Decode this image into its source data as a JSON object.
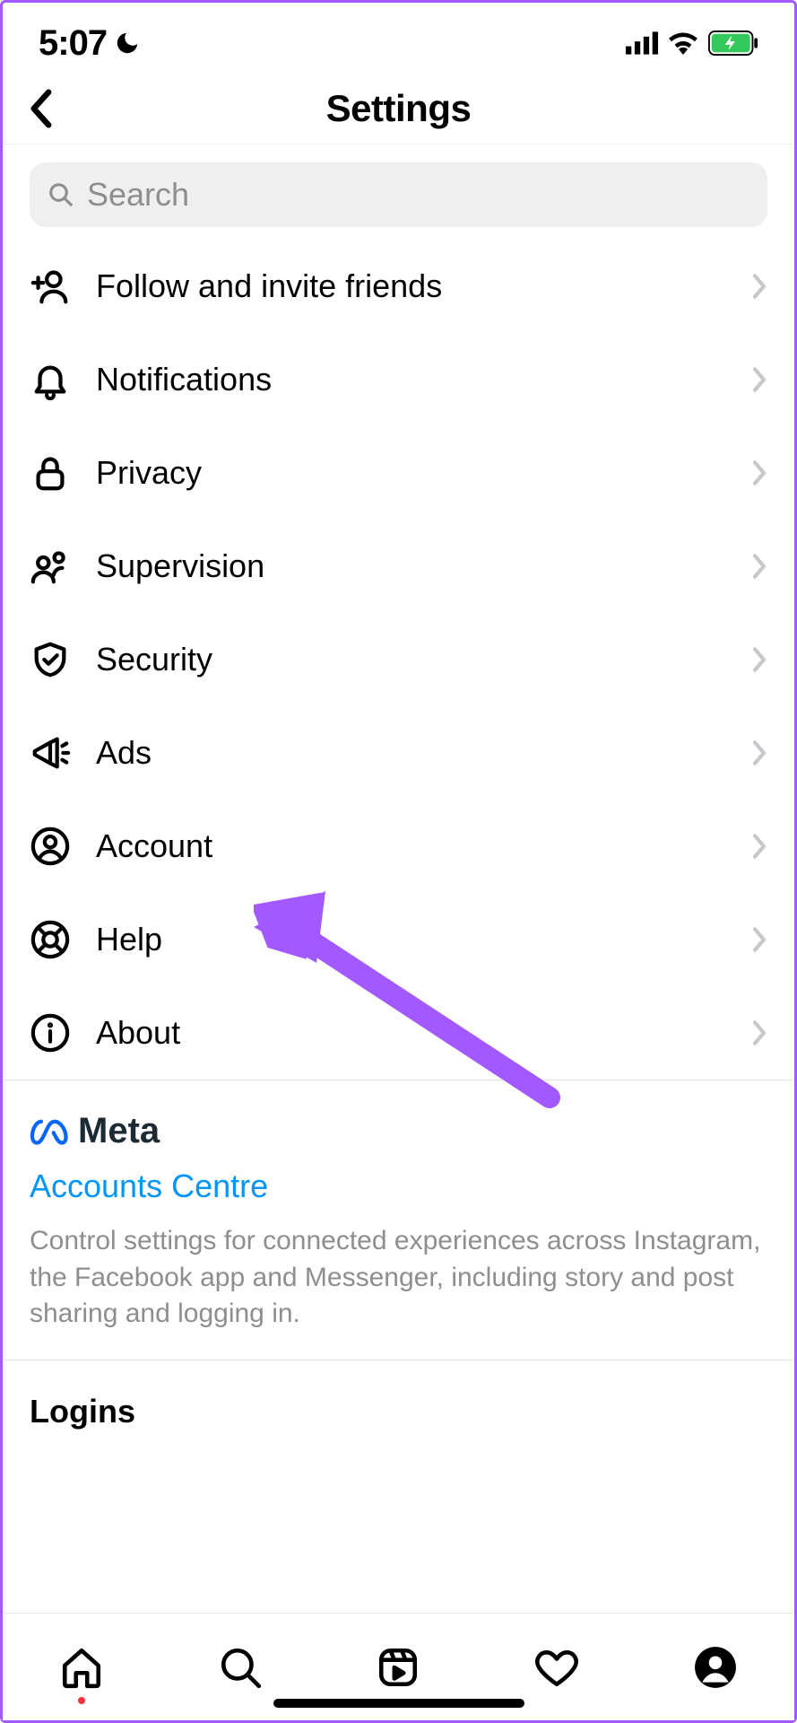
{
  "status": {
    "time": "5:07"
  },
  "header": {
    "title": "Settings"
  },
  "search": {
    "placeholder": "Search"
  },
  "menu": [
    {
      "icon": "user-plus-icon",
      "label": "Follow and invite friends"
    },
    {
      "icon": "bell-icon",
      "label": "Notifications"
    },
    {
      "icon": "lock-icon",
      "label": "Privacy"
    },
    {
      "icon": "supervision-icon",
      "label": "Supervision"
    },
    {
      "icon": "shield-check-icon",
      "label": "Security"
    },
    {
      "icon": "megaphone-icon",
      "label": "Ads"
    },
    {
      "icon": "account-icon",
      "label": "Account"
    },
    {
      "icon": "lifebuoy-icon",
      "label": "Help"
    },
    {
      "icon": "info-icon",
      "label": "About"
    }
  ],
  "meta": {
    "brand": "Meta",
    "link": "Accounts Centre",
    "description": "Control settings for connected experiences across Instagram, the Facebook app and Messenger, including story and post sharing and logging in."
  },
  "logins": {
    "title": "Logins"
  },
  "annotation": {
    "target": "Account",
    "color": "#a259ff"
  }
}
